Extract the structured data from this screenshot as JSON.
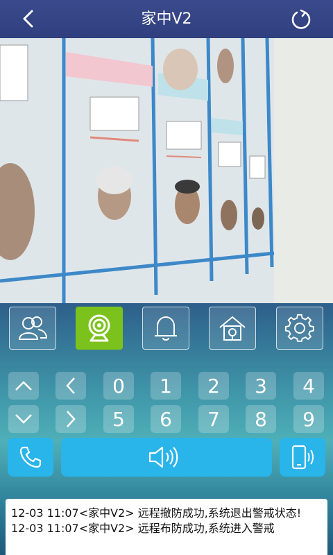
{
  "header": {
    "title": "家中V2"
  },
  "controls": {
    "tiles": [
      {
        "icon": "users-icon"
      },
      {
        "icon": "camera-icon",
        "active": true
      },
      {
        "icon": "bell-icon"
      },
      {
        "icon": "home-icon"
      },
      {
        "icon": "gear-icon"
      }
    ],
    "keys_row1": [
      "0",
      "1",
      "2",
      "3",
      "4"
    ],
    "keys_row2": [
      "5",
      "6",
      "7",
      "8",
      "9"
    ],
    "accent": "#7cc21c",
    "button_blue": "#29b4ea"
  },
  "log": {
    "lines": [
      "12-03 11:07<家中V2> 远程撤防成功,系统退出警戒状态!",
      "12-03 11:07<家中V2> 远程布防成功,系统进入警戒"
    ]
  }
}
